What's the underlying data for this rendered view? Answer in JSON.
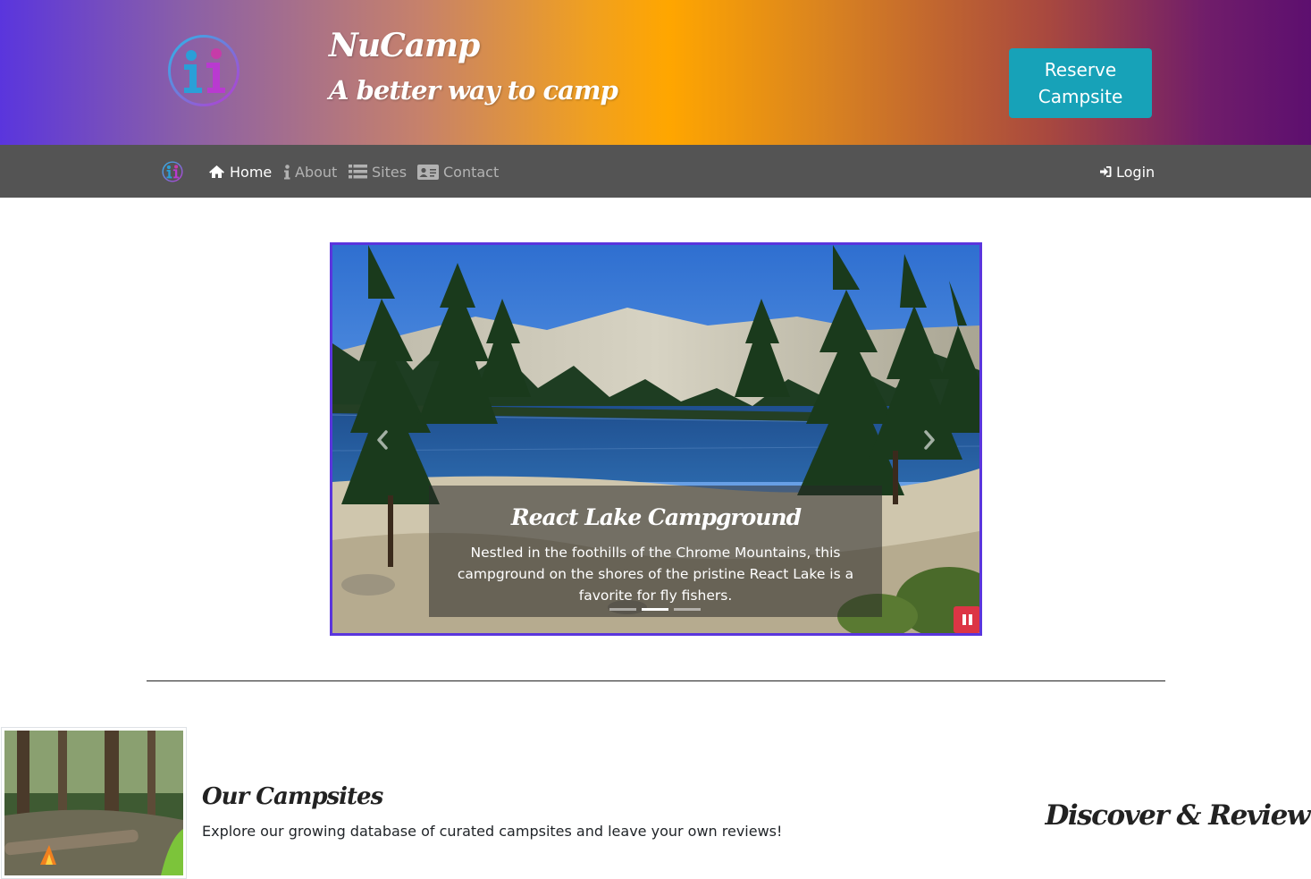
{
  "header": {
    "brand_title": "NuCamp",
    "brand_subtitle": "A better way to camp",
    "reserve_button": "Reserve Campsite"
  },
  "nav": {
    "items": [
      {
        "label": "Home",
        "icon": "home-icon",
        "active": true
      },
      {
        "label": "About",
        "icon": "info-icon",
        "active": false
      },
      {
        "label": "Sites",
        "icon": "list-icon",
        "active": false
      },
      {
        "label": "Contact",
        "icon": "address-card-icon",
        "active": false
      }
    ],
    "login": {
      "label": "Login",
      "icon": "sign-in-icon"
    }
  },
  "carousel": {
    "title": "React Lake Campground",
    "text": "Nestled in the foothills of the Chrome Mountains, this campground on the shores of the pristine React Lake is a favorite for fly fishers.",
    "slide_count": 3,
    "active_slide": 2,
    "border_color": "#5a35dd",
    "pause_color": "#dc3545"
  },
  "feature": {
    "title": "Our Campsites",
    "text": "Explore our growing database of curated campsites and leave your own reviews!",
    "side_title": "Discover & Review"
  },
  "colors": {
    "nav_bg": "#545454",
    "reserve_bg": "#17a2b8"
  }
}
